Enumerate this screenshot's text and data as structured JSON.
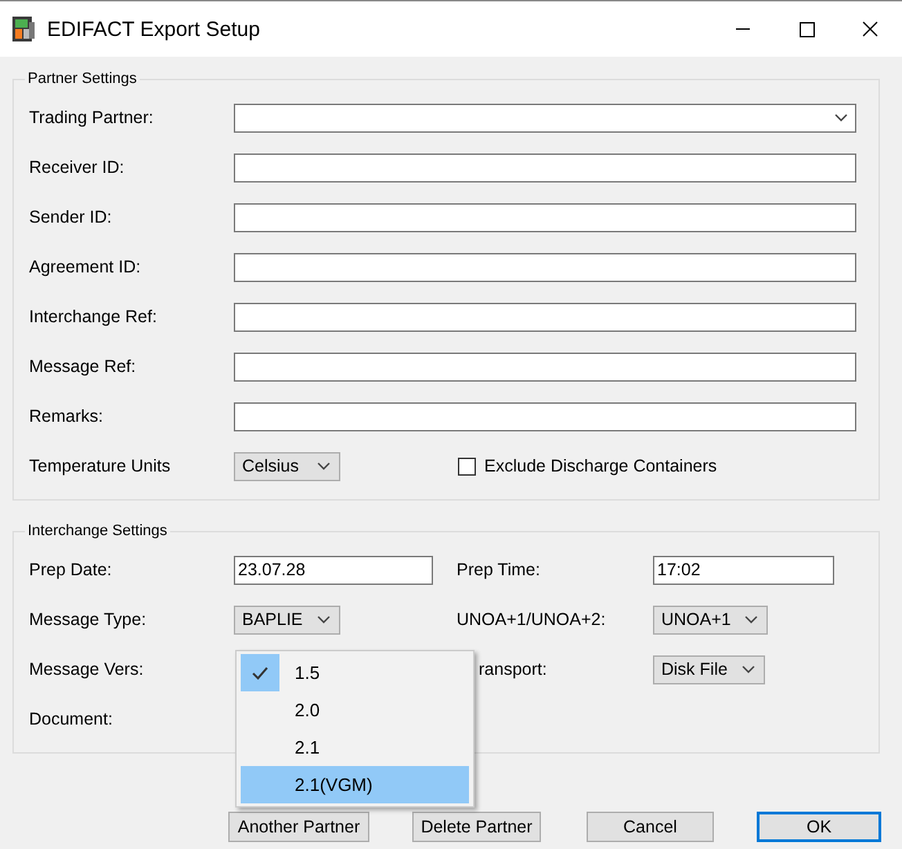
{
  "window": {
    "title": "EDIFACT Export Setup"
  },
  "partner_settings": {
    "title": "Partner Settings",
    "fields": [
      {
        "label": "Trading Partner:",
        "kind": "combo"
      },
      {
        "label": "Receiver ID:",
        "kind": "text"
      },
      {
        "label": "Sender ID:",
        "kind": "text"
      },
      {
        "label": "Agreement ID:",
        "kind": "text"
      },
      {
        "label": "Interchange Ref:",
        "kind": "text"
      },
      {
        "label": "Message Ref:",
        "kind": "text"
      },
      {
        "label": "Remarks:",
        "kind": "text"
      }
    ],
    "temperature": {
      "label": "Temperature Units",
      "value": "Celsius"
    },
    "exclude": {
      "label": "Exclude Discharge Containers",
      "checked": false
    }
  },
  "interchange_settings": {
    "title": "Interchange Settings",
    "rows": [
      [
        {
          "label": "Prep Date:",
          "kind": "text",
          "value": "23.07.28"
        },
        {
          "label": "Prep Time:",
          "kind": "text",
          "value": "17:02"
        }
      ],
      [
        {
          "label": "Message Type:",
          "kind": "combo",
          "value": "BAPLIE"
        },
        {
          "label": "UNOA+1/UNOA+2:",
          "kind": "combo",
          "value": "UNOA+1"
        }
      ],
      [
        {
          "label": "Message Vers:",
          "kind": "none"
        },
        {
          "label": "ransport:",
          "kind": "combo",
          "value": "Disk File",
          "clipped": true
        }
      ],
      [
        {
          "label": "Document:",
          "kind": "none"
        }
      ]
    ]
  },
  "version_menu": {
    "items": [
      {
        "label": "1.5",
        "checked": true,
        "selected": false
      },
      {
        "label": "2.0",
        "checked": false,
        "selected": false
      },
      {
        "label": "2.1",
        "checked": false,
        "selected": false
      },
      {
        "label": "2.1(VGM)",
        "checked": false,
        "selected": true
      }
    ]
  },
  "buttons": [
    {
      "label": "Another Partner",
      "default": false
    },
    {
      "label": "Delete Partner",
      "default": false
    },
    {
      "label": "Cancel",
      "default": false
    },
    {
      "label": "OK",
      "default": true
    }
  ]
}
